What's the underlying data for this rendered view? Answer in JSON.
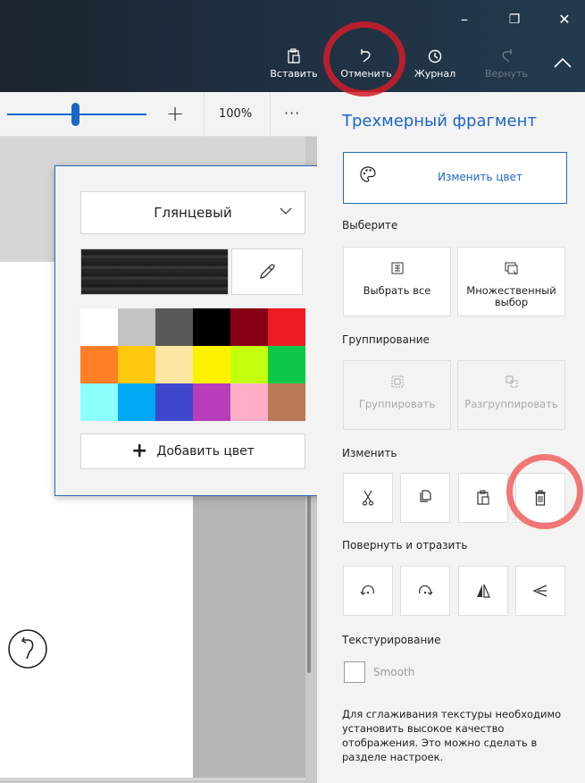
{
  "window": {
    "minimize_glyph": "–",
    "restore_glyph": "❐",
    "close_glyph": "✕"
  },
  "toolbar": {
    "paste_label": "Вставить",
    "undo_label": "Отменить",
    "history_label": "Журнал",
    "redo_label": "Вернуть"
  },
  "canvas_toolbar": {
    "zoom_level": "100%",
    "more_glyph": "···",
    "plus_glyph": "+"
  },
  "color_popup": {
    "finish_selected": "Глянцевый",
    "add_color_label": "Добавить цвет",
    "palette": [
      "#ffffff",
      "#c3c3c3",
      "#585858",
      "#000000",
      "#880015",
      "#ed1c24",
      "#ff7f27",
      "#ffc90e",
      "#fde6a3",
      "#fff200",
      "#c4ff0e",
      "#0fc84a",
      "#8cfffb",
      "#00a8f3",
      "#3f48cc",
      "#b83dba",
      "#ffaec8",
      "#b97a57"
    ]
  },
  "panel": {
    "title": "Трехмерный фрагмент",
    "edit_color_label": "Изменить цвет",
    "select_section": "Выберите",
    "select_all_label": "Выбрать все",
    "multi_select_label": "Множественный выбор",
    "group_section": "Группирование",
    "group_label": "Группировать",
    "ungroup_label": "Разгруппировать",
    "edit_section": "Изменить",
    "rotate_section": "Повернуть и отразить",
    "texture_section": "Текстурирование",
    "smooth_label": "Smooth",
    "note": "Для сглаживания текстуры необходимо установить высокое качество отображения. Это можно сделать в разделе настроек."
  },
  "colors": {
    "accent": "#1b66c9",
    "annotation": "#d21c28"
  }
}
